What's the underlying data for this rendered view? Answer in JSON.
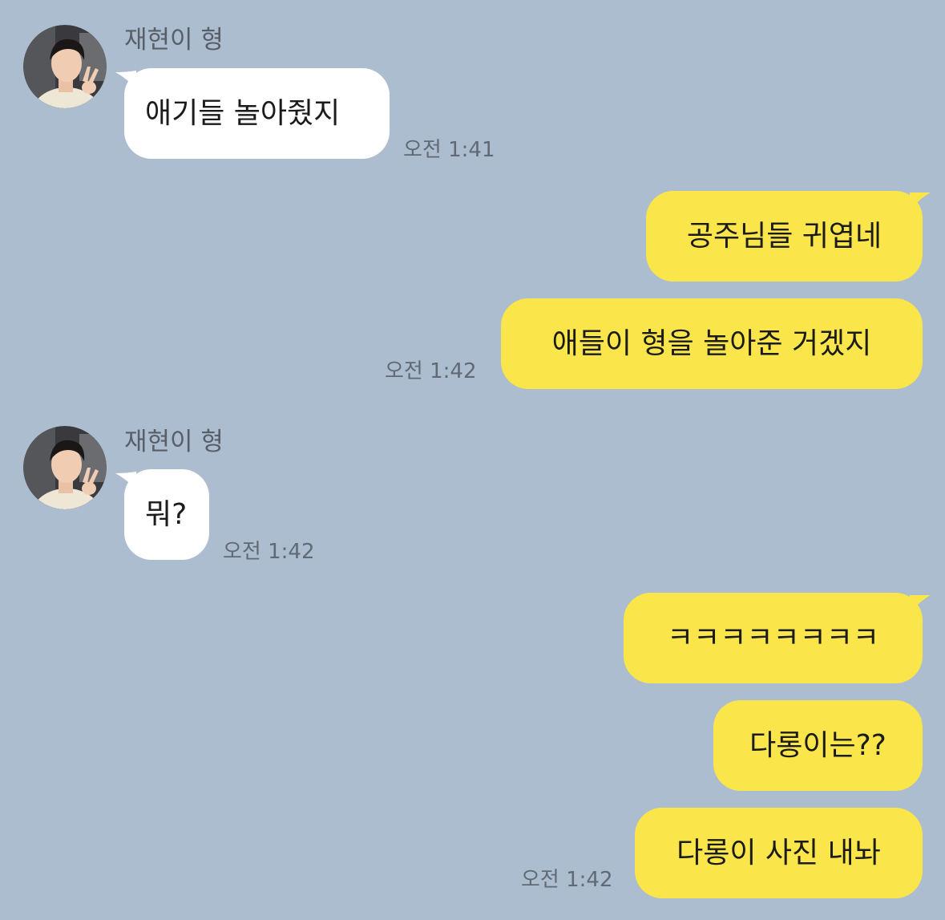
{
  "colors": {
    "background": "#abbdcf",
    "incoming_bubble": "#ffffff",
    "outgoing_bubble": "#fae54a",
    "timestamp": "#616a74",
    "sender_name": "#585f68"
  },
  "messages": [
    {
      "direction": "incoming",
      "sender": "재현이 형",
      "avatar_icon": "profile-photo",
      "text": "애기들 놀아줬지",
      "time": "오전 1:41"
    },
    {
      "direction": "outgoing",
      "text": "공주님들 귀엽네"
    },
    {
      "direction": "outgoing",
      "text": "애들이 형을 놀아준 거겠지",
      "time": "오전 1:42"
    },
    {
      "direction": "incoming",
      "sender": "재현이 형",
      "avatar_icon": "profile-photo",
      "text": "뭐?",
      "time": "오전 1:42"
    },
    {
      "direction": "outgoing",
      "text": "ㅋㅋㅋㅋㅋㅋㅋㅋ"
    },
    {
      "direction": "outgoing",
      "text": "다롱이는??"
    },
    {
      "direction": "outgoing",
      "text": "다롱이 사진 내놔",
      "time": "오전 1:42"
    }
  ]
}
